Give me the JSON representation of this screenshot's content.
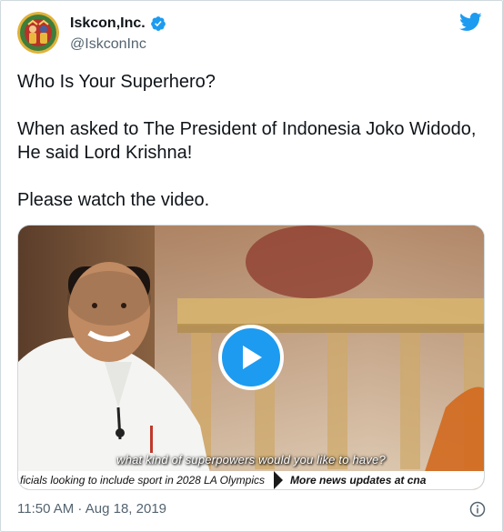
{
  "author": {
    "display_name": "Iskcon,Inc.",
    "handle": "@IskconInc",
    "avatar_icon": "deity-avatar",
    "verified_icon": "verified-badge-icon"
  },
  "tweet": {
    "lines": [
      "Who Is Your Superhero?",
      "When asked to The President of Indonesia Joko Widodo, He said Lord Krishna!",
      "Please watch the video."
    ]
  },
  "media": {
    "subtitle": "what kind of superpowers would you like to have?",
    "ticker_left": "ficials looking to include sport in 2028 LA Olympics",
    "ticker_right": "More news updates at cna"
  },
  "meta": {
    "timestamp": "11:50 AM · Aug 18, 2019"
  },
  "colors": {
    "twitter_blue": "#1d9bf0",
    "text": "#0f1419",
    "muted": "#536471",
    "border": "#cfd9de"
  }
}
